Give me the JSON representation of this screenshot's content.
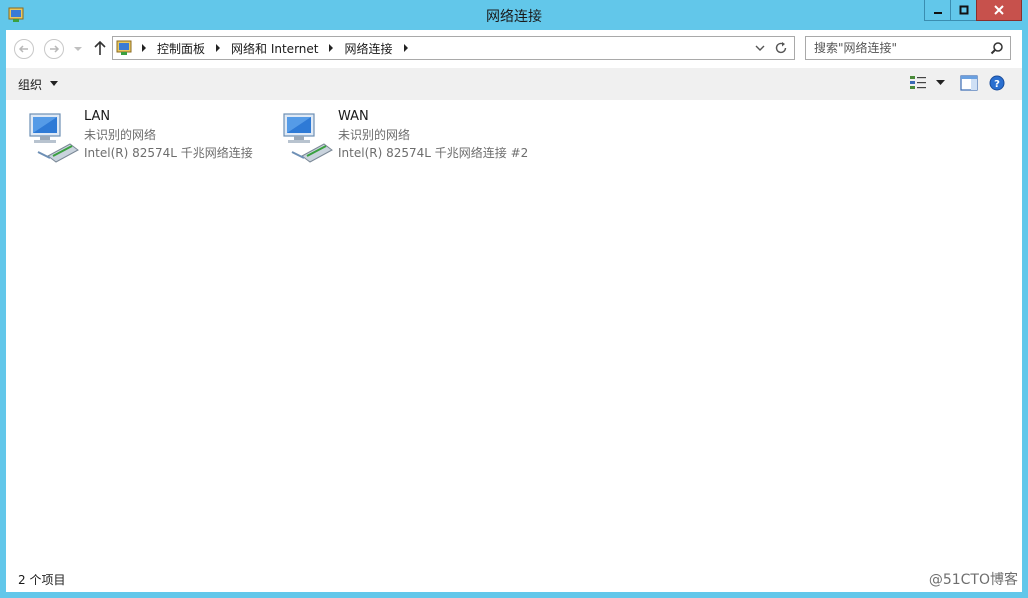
{
  "window": {
    "title": "网络连接"
  },
  "navigation": {
    "breadcrumbs": [
      "控制面板",
      "网络和 Internet",
      "网络连接"
    ]
  },
  "search": {
    "placeholder": "搜索\"网络连接\""
  },
  "toolbar": {
    "organize_label": "组织"
  },
  "connections": [
    {
      "name": "LAN",
      "status": "未识别的网络",
      "adapter": "Intel(R) 82574L 千兆网络连接"
    },
    {
      "name": "WAN",
      "status": "未识别的网络",
      "adapter": "Intel(R) 82574L 千兆网络连接 #2"
    }
  ],
  "statusbar": {
    "item_count": "2 个项目",
    "watermark": "@51CTO博客"
  },
  "icons": {
    "app": "network-connections-icon",
    "back": "back-arrow-icon",
    "forward": "forward-arrow-icon",
    "up": "up-arrow-icon",
    "refresh": "refresh-icon",
    "search": "search-icon",
    "view": "change-view-icon",
    "preview_pane": "preview-pane-icon",
    "help": "help-icon",
    "connection": "network-adapter-icon"
  },
  "colors": {
    "title_bar": "#62c7ea",
    "close_button": "#c7514c",
    "toolbar_bg": "#f0f0f0",
    "secondary_text": "#6d6d6d"
  }
}
